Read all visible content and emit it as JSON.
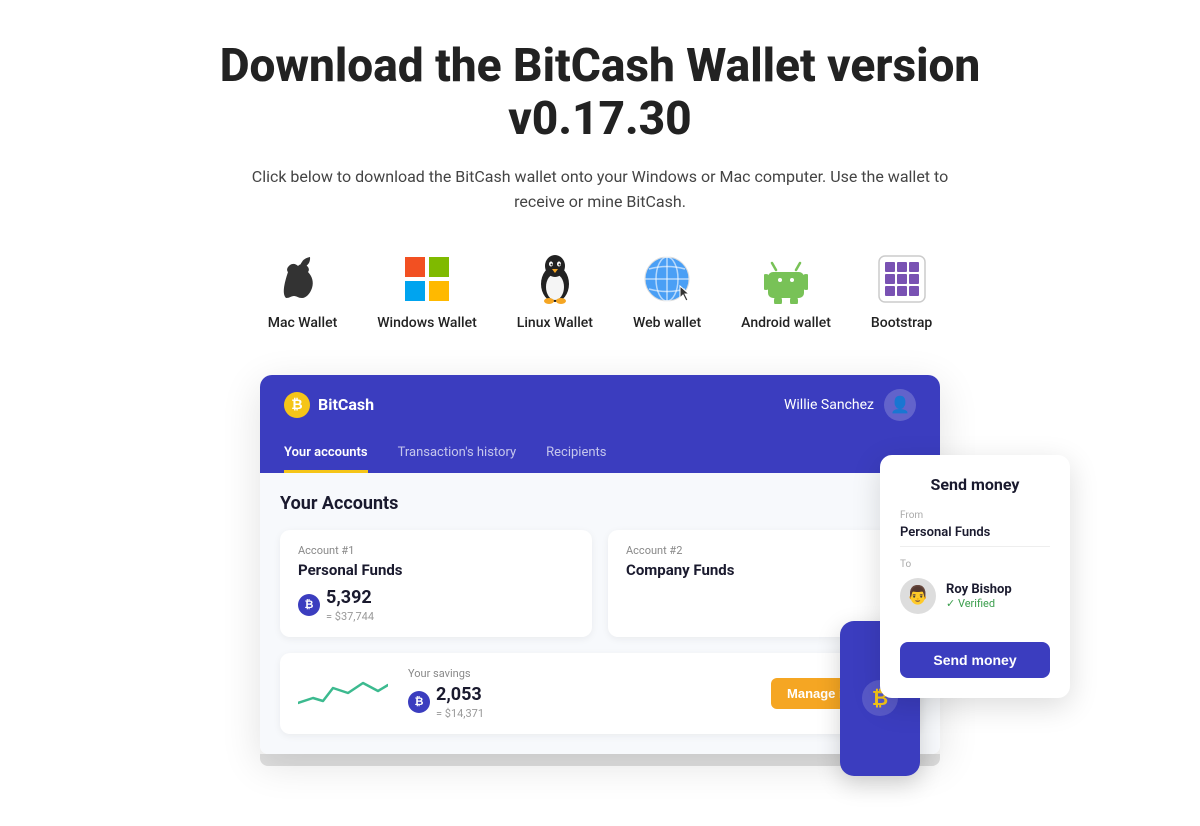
{
  "header": {
    "title": "Download the BitCash Wallet version v0.17.30",
    "subtitle": "Click below to download the BitCash wallet onto your Windows or Mac computer. Use the wallet to receive or mine BitCash."
  },
  "wallets": [
    {
      "id": "mac",
      "label": "Mac Wallet",
      "icon": "apple"
    },
    {
      "id": "windows",
      "label": "Windows Wallet",
      "icon": "windows"
    },
    {
      "id": "linux",
      "label": "Linux Wallet",
      "icon": "linux"
    },
    {
      "id": "web",
      "label": "Web wallet",
      "icon": "globe"
    },
    {
      "id": "android",
      "label": "Android wallet",
      "icon": "android"
    },
    {
      "id": "bootstrap",
      "label": "Bootstrap",
      "icon": "bootstrap"
    }
  ],
  "app": {
    "brand": "BitCash",
    "user": "Willie Sanchez",
    "tabs": [
      {
        "id": "accounts",
        "label": "Your accounts",
        "active": true
      },
      {
        "id": "history",
        "label": "Transaction's history",
        "active": false
      },
      {
        "id": "recipients",
        "label": "Recipients",
        "active": false
      }
    ],
    "accounts_title": "Your Accounts",
    "accounts": [
      {
        "label": "Account #1",
        "name": "Personal Funds",
        "amount": "5,392",
        "usd": "= $37,744"
      },
      {
        "label": "Account #2",
        "name": "Company Funds",
        "amount": "",
        "usd": ""
      }
    ],
    "savings": {
      "label": "Your savings",
      "amount": "2,053",
      "usd": "= $14,371",
      "button": "Manage interest"
    }
  },
  "send_money": {
    "title": "Send money",
    "from_label": "From",
    "from_value": "Personal Funds",
    "to_label": "To",
    "recipient_name": "Roy Bishop",
    "verified": "✓ Verified",
    "button": "Send money"
  }
}
